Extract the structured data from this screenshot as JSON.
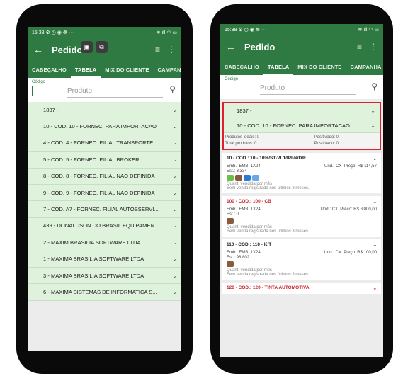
{
  "left": {
    "status": {
      "time": "15:38",
      "icons_left": "⚙ ◷ ◉ ☸ ···",
      "icons_right": "≋ ıll ◠ ▭"
    },
    "appbar": {
      "title": "Pedido"
    },
    "tabs": [
      "CABEÇALHO",
      "TABELA",
      "MIX DO CLIENTE",
      "CAMPANHA"
    ],
    "active_tab": 1,
    "search": {
      "code_label": "Código",
      "product_placeholder": "Produto"
    },
    "groups": [
      "1837 -",
      "10 - COD. 10 - FORNEC. PARA IMPORTACAO",
      "4 - COD. 4 - FORNEC. FILIAL TRANSPORTE",
      "5 - COD. 5 - FORNEC. FILIAL BROKER",
      "8 - COD. 8 - FORNEC. FILIAL NAO DEFINIDA",
      "9 - COD. 9 - FORNEC. FILIAL NAO DEFINIDA",
      "7 - COD. A7 - FORNEC. FILIAL AUTOSSERVI...",
      "439 - DONALDSON DO BRASIL EQUIPAMEN...",
      "2 - MAXIM BRASILIA SOFTWARE LTDA",
      "1 - MAXIMA BRASILIA SOFTWARE LTDA",
      "3 - MAXIMA BRASILIA SOFTWARE LTDA",
      "6 - MAXIMA SISTEMAS DE INFORMATICA S..."
    ]
  },
  "right": {
    "status": {
      "time": "15:38",
      "icons_left": "⚙ ◷ ◉ ☸ ···",
      "icons_right": "≋ ıll ◠ ▭"
    },
    "appbar": {
      "title": "Pedido"
    },
    "tabs": [
      "CABEÇALHO",
      "TABELA",
      "MIX DO CLIENTE",
      "CAMPANHA"
    ],
    "search": {
      "code_label": "Código",
      "product_placeholder": "Produto"
    },
    "selected": {
      "group1": "1837 -",
      "group2": "10 - COD. 10 - FORNEC. PARA IMPORTACAO",
      "ideais": "Produtos ideais: 0",
      "total": "Total produtos: 0",
      "positivado1": "Positivado: 0",
      "positivado2": "Positivado: 0"
    },
    "products": [
      {
        "title": "10 - COD.: 10 - 10%/ST-VL1/IPI-N/DIF",
        "emb": "Emb.: EMB. 1X24",
        "und": "Und.: CX",
        "preco": "Preço: R$ 114,57",
        "est": "Est.: 3.334",
        "quant": "Quant. vendida por mês",
        "sem": "Sem venda registrada nos últimos 3 meses.",
        "red": false
      },
      {
        "title": "100 - COD.: 100 - CB",
        "emb": "Emb.: EMB. 1X24",
        "und": "Und.: CX",
        "preco": "Preço: R$ 8.000,00",
        "est": "Est.: 0",
        "quant": "Quant. vendida por mês",
        "sem": "Sem venda registrada nos últimos 3 meses.",
        "red": true
      },
      {
        "title": "110 - COD.: 110 - KIT",
        "emb": "Emb.: EMB. 1X24",
        "und": "Und.: CX",
        "preco": "Preço: R$ 100,00",
        "est": "Est.: 98.802",
        "quant": "Quant. vendida por mês",
        "sem": "Sem venda registrada nos últimos 3 meses.",
        "red": false
      }
    ],
    "last": "120 - COD.: 120 - TINTA AUTOMOTIVA"
  },
  "icons": {
    "back": "←",
    "filter": "≡",
    "more": "⋮",
    "search": "⚲",
    "chevron": "⌄"
  },
  "colors": {
    "primary": "#2f7a42",
    "group_bg": "#dff2dc",
    "highlight": "#e0202a"
  }
}
